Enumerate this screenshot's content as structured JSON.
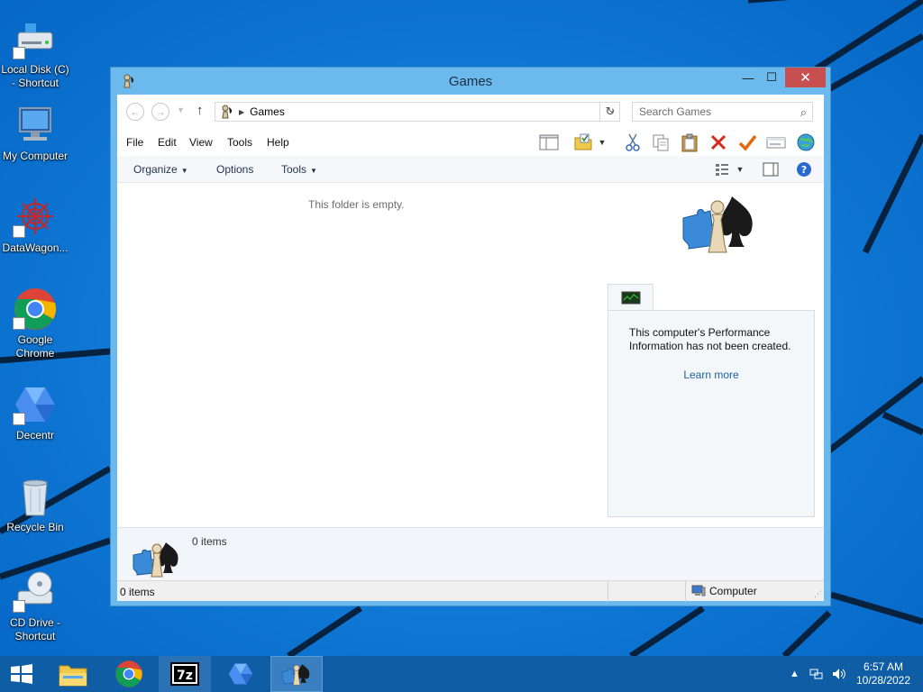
{
  "desktop": {
    "icons": [
      {
        "label": "Local Disk (C) - Shortcut",
        "icon": "hard-drive-icon"
      },
      {
        "label": "My Computer",
        "icon": "computer-monitor-icon"
      },
      {
        "label": "DataWagon...",
        "icon": "datawagon-icon"
      },
      {
        "label": "Google Chrome",
        "icon": "chrome-icon"
      },
      {
        "label": "Decentr",
        "icon": "decentr-icon"
      },
      {
        "label": "Recycle Bin",
        "icon": "recycle-bin-icon"
      },
      {
        "label": "CD Drive - Shortcut",
        "icon": "cd-drive-icon"
      }
    ]
  },
  "window": {
    "title": "Games",
    "min_glyph": "—",
    "max_glyph": "☐",
    "close_glyph": "✕"
  },
  "address": {
    "path": "Games",
    "search_placeholder": "Search Games"
  },
  "menu": {
    "file": "File",
    "edit": "Edit",
    "view": "View",
    "tools": "Tools",
    "help": "Help"
  },
  "commands": {
    "organize": "Organize",
    "options": "Options",
    "tools": "Tools"
  },
  "content": {
    "empty_message": "This folder is empty.",
    "perf_text": "This computer's Performance Information has not been created.",
    "perf_link": "Learn more"
  },
  "details": {
    "count": "0 items"
  },
  "status": {
    "count": "0 items",
    "location": "Computer"
  },
  "taskbar": {
    "apps": [
      "start-icon",
      "file-explorer-icon",
      "chrome-icon",
      "7zip-icon",
      "decentr-icon",
      "games-icon"
    ],
    "time": "6:57 AM",
    "date": "10/28/2022"
  },
  "colors": {
    "desktop_bg": "#0a74d4",
    "window_frame": "#6cb9ee",
    "close_button": "#c74f50",
    "taskbar": "#0f5ea5",
    "link": "#1b5fa8"
  }
}
